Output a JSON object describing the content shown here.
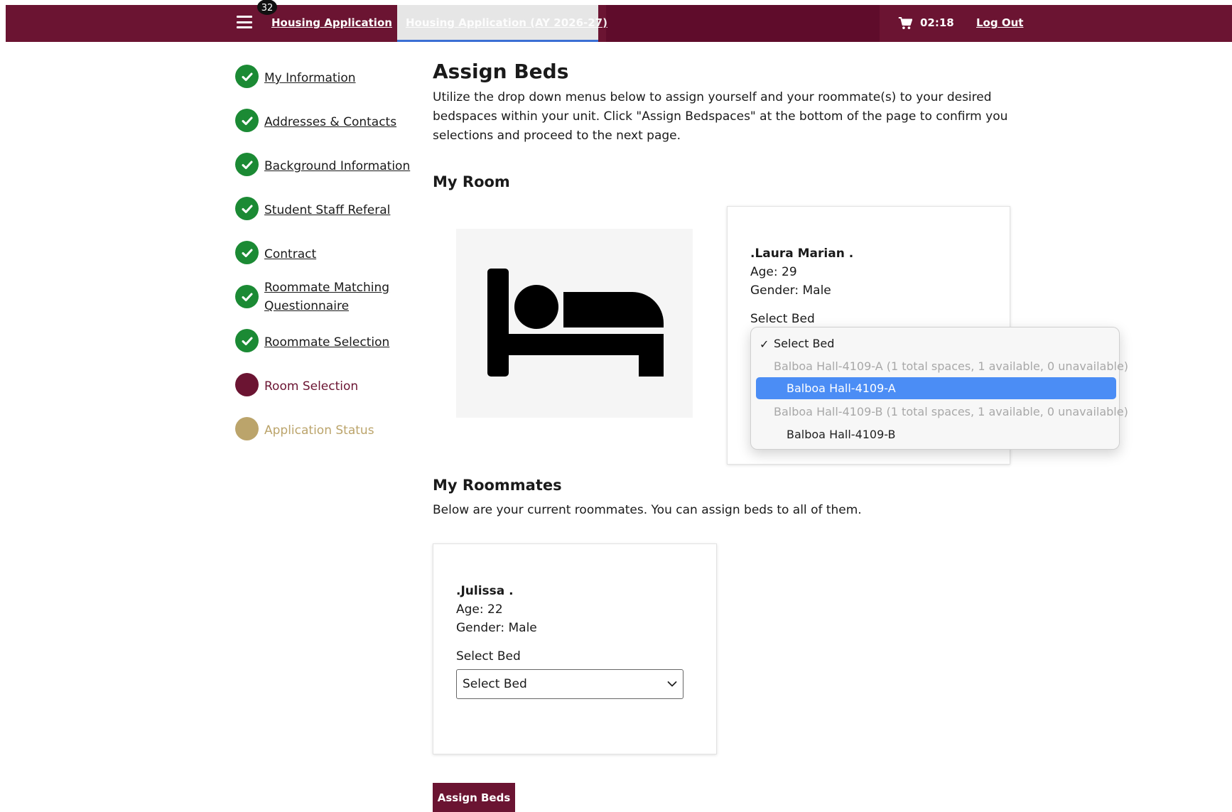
{
  "header": {
    "badge_count": "32",
    "nav_primary": "Housing Application",
    "nav_active_tab": "Housing Application (AY 2026-27)",
    "cart_timer": "02:18",
    "logout": "Log Out",
    "colors": {
      "brand": "#6b1432",
      "brand_dark": "#5f0c2b"
    }
  },
  "steps": [
    {
      "label": "My Information",
      "status": "done"
    },
    {
      "label": "Addresses & Contacts",
      "status": "done"
    },
    {
      "label": "Background Information",
      "status": "done"
    },
    {
      "label": "Student Staff Referal",
      "status": "done"
    },
    {
      "label": "Contract",
      "status": "done"
    },
    {
      "label": "Roommate Matching Questionnaire",
      "status": "done"
    },
    {
      "label": "Roommate Selection",
      "status": "done"
    },
    {
      "label": "Room Selection",
      "status": "current"
    },
    {
      "label": "Application Status",
      "status": "pending"
    }
  ],
  "main": {
    "title": "Assign Beds",
    "intro": "Utilize the drop down menus below to assign yourself and your roommate(s) to your desired bedspaces within your unit. Click \"Assign Bedspaces\" at the bottom of the page to confirm you selections and proceed to the next page.",
    "my_room_heading": "My Room",
    "bed_icon": "bed-icon",
    "me": {
      "name": ".Laura Marian .",
      "age": "Age: 29",
      "gender": "Gender: Male",
      "select_label": "Select Bed",
      "dropdown": {
        "selected": "Select Bed",
        "options": [
          {
            "label": "Balboa Hall-4109-A (1 total spaces, 1 available, 0 unavailable)",
            "state": "disabled"
          },
          {
            "label": "Balboa Hall-4109-A",
            "state": "highlighted"
          },
          {
            "label": "Balboa Hall-4109-B (1 total spaces, 1 available, 0 unavailable)",
            "state": "disabled"
          },
          {
            "label": "Balboa Hall-4109-B",
            "state": "normal"
          }
        ]
      }
    },
    "roommates_heading": "My Roommates",
    "roommates_text": "Below are your current roommates. You can assign beds to all of them.",
    "roommate": {
      "name": ".Julissa .",
      "age": "Age: 22",
      "gender": "Gender: Male",
      "select_label": "Select Bed",
      "select_value": "Select Bed"
    },
    "assign_button": "Assign Beds"
  }
}
